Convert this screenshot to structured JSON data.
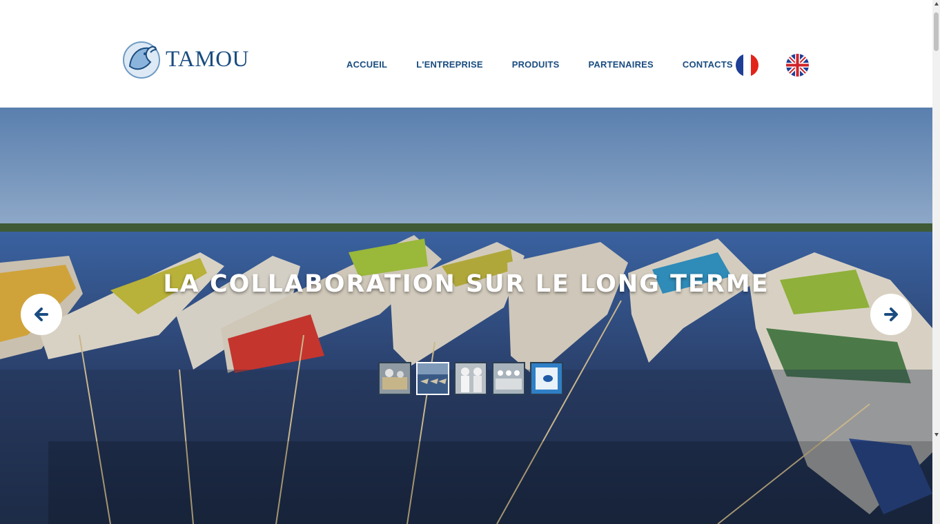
{
  "brand": {
    "name": "TAMOU",
    "logo_icon": "fish-logo-icon"
  },
  "nav": {
    "items": [
      {
        "label": "ACCUEIL"
      },
      {
        "label": "L'ENTREPRISE"
      },
      {
        "label": "PRODUITS"
      },
      {
        "label": "PARTENAIRES"
      },
      {
        "label": "CONTACTS"
      }
    ],
    "languages": [
      {
        "code": "fr",
        "icon": "french-flag-icon"
      },
      {
        "code": "en",
        "icon": "uk-flag-icon"
      }
    ]
  },
  "slider": {
    "headline": "LA COLLABORATION SUR LE LONG TERME",
    "prev_icon": "arrow-left-icon",
    "next_icon": "arrow-right-icon",
    "active_index": 1,
    "thumbnails": [
      {
        "subject": "processing-workers"
      },
      {
        "subject": "pirogue-boats"
      },
      {
        "subject": "staff-in-uniforms"
      },
      {
        "subject": "factory-floor"
      },
      {
        "subject": "blue-logo-card"
      }
    ]
  },
  "colors": {
    "brand_blue": "#1a4c80",
    "arrow_blue": "#1a4c80",
    "white": "#ffffff"
  }
}
